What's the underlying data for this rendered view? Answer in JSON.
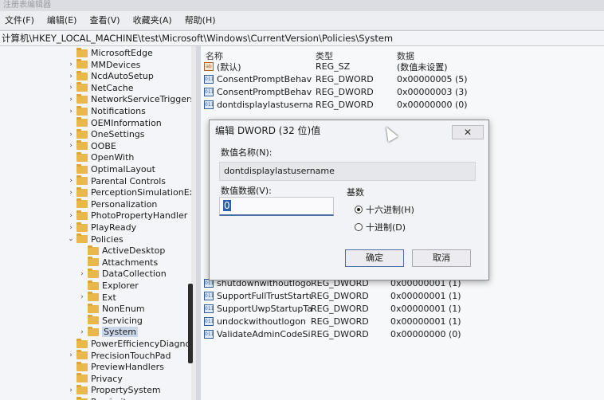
{
  "window": {
    "title": "注册表编辑器"
  },
  "menu": [
    "文件(F)",
    "编辑(E)",
    "查看(V)",
    "收藏夹(A)",
    "帮助(H)"
  ],
  "address": "计算机\\HKEY_LOCAL_MACHINE\\test\\Microsoft\\Windows\\CurrentVersion\\Policies\\System",
  "tree": [
    {
      "label": "MicrosoftEdge",
      "chev": ""
    },
    {
      "label": "MMDevices",
      "chev": ">"
    },
    {
      "label": "NcdAutoSetup",
      "chev": ">"
    },
    {
      "label": "NetCache",
      "chev": ">"
    },
    {
      "label": "NetworkServiceTriggers",
      "chev": ">"
    },
    {
      "label": "Notifications",
      "chev": ">"
    },
    {
      "label": "OEMInformation",
      "chev": ""
    },
    {
      "label": "OneSettings",
      "chev": ">"
    },
    {
      "label": "OOBE",
      "chev": ">"
    },
    {
      "label": "OpenWith",
      "chev": ""
    },
    {
      "label": "OptimalLayout",
      "chev": ""
    },
    {
      "label": "Parental Controls",
      "chev": ">"
    },
    {
      "label": "PerceptionSimulationExt",
      "chev": ">"
    },
    {
      "label": "Personalization",
      "chev": ""
    },
    {
      "label": "PhotoPropertyHandler",
      "chev": ">"
    },
    {
      "label": "PlayReady",
      "chev": ">"
    },
    {
      "label": "Policies",
      "chev": "v"
    },
    {
      "label": "ActiveDesktop",
      "chev": ""
    },
    {
      "label": "Attachments",
      "chev": ""
    },
    {
      "label": "DataCollection",
      "chev": ">"
    },
    {
      "label": "Explorer",
      "chev": ""
    },
    {
      "label": "Ext",
      "chev": ">"
    },
    {
      "label": "NonEnum",
      "chev": ""
    },
    {
      "label": "Servicing",
      "chev": ""
    },
    {
      "label": "System",
      "chev": ">"
    },
    {
      "label": "PowerEfficiencyDiagnost",
      "chev": ""
    },
    {
      "label": "PrecisionTouchPad",
      "chev": ">"
    },
    {
      "label": "PreviewHandlers",
      "chev": ""
    },
    {
      "label": "Privacy",
      "chev": ""
    },
    {
      "label": "PropertySystem",
      "chev": ">"
    },
    {
      "label": "Proximity",
      "chev": ">"
    }
  ],
  "list": {
    "headers": {
      "name": "名称",
      "type": "类型",
      "data": "数据"
    },
    "top_rows": [
      {
        "name": "(默认)",
        "type": "REG_SZ",
        "data": "(数值未设置)"
      },
      {
        "name": "ConsentPromptBehavi...",
        "type": "REG_DWORD",
        "data": "0x00000005 (5)"
      },
      {
        "name": "ConsentPromptBehavi...",
        "type": "REG_DWORD",
        "data": "0x00000003 (3)"
      },
      {
        "name": "dontdisplaylastuserna...",
        "type": "REG_DWORD",
        "data": "0x00000000 (0)"
      }
    ],
    "bottom_rows": [
      {
        "name": "shutdownwithoutlogon",
        "type": "REG_DWORD",
        "data": "0x00000001 (1)"
      },
      {
        "name": "SupportFullTrustStartu...",
        "type": "REG_DWORD",
        "data": "0x00000001 (1)"
      },
      {
        "name": "SupportUwpStartupTa...",
        "type": "REG_DWORD",
        "data": "0x00000001 (1)"
      },
      {
        "name": "undockwithoutlogon",
        "type": "REG_DWORD",
        "data": "0x00000001 (1)"
      },
      {
        "name": "ValidateAdminCodeSi...",
        "type": "REG_DWORD",
        "data": "0x00000000 (0)"
      }
    ]
  },
  "dialog": {
    "title": "编辑 DWORD (32 位)值",
    "close": "✕",
    "name_label": "数值名称(N):",
    "name_value": "dontdisplaylastusername",
    "data_label": "数值数据(V):",
    "data_value": "0",
    "base_label": "基数",
    "hex_label": "十六进制(H)",
    "dec_label": "十进制(D)",
    "ok": "确定",
    "cancel": "取消"
  }
}
